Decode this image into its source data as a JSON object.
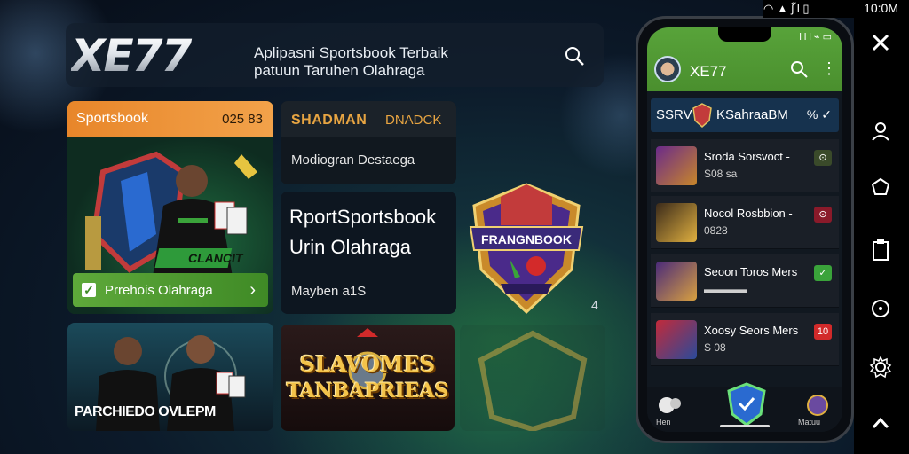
{
  "header": {
    "logo": "XE77",
    "tagline_line1": "Aplipasni Sportsbook Terbaik",
    "tagline_line2": "patuun Taruhen Olahraga",
    "search_icon": "search-icon"
  },
  "cards": {
    "sportsbook": {
      "title": "Sportsbook",
      "code": "025 83",
      "art_label": "CLANCIT",
      "cta_label": "Prrehois Olahraga",
      "cta_check": "✓",
      "cta_arrow": "›"
    },
    "shadman": {
      "tab1": "SHADMAN",
      "tab2": "DNADCK",
      "text": "Modiogran Destaega"
    },
    "rport": {
      "line1": "RportSportsbook",
      "line2": "Urin Olahraga",
      "line3": "Mayben a1S"
    },
    "shield": {
      "label": "FRANGNBOOK"
    },
    "small_glyph": "4",
    "players": {
      "label": "PARCHIEDO OVLEPM"
    },
    "slots": {
      "line1": "SLAVOMES",
      "line2": "TANBAPRIEAS"
    }
  },
  "phone": {
    "status": "l l l ⌁ ▭",
    "app_title": "XE77",
    "menu": "⋮",
    "sub_bar": {
      "title": "SSRV",
      "name": "KSahraaBM",
      "meta": "% ✓"
    },
    "items": [
      {
        "title": "Sroda Sorsvoct  -",
        "sub": "S08 sa",
        "badge": "⊙",
        "badge_color": "#3a4a2a"
      },
      {
        "title": "Nocol Rosbbion  -",
        "sub": "0828",
        "badge": "⊙",
        "badge_color": "#8a1a2a"
      },
      {
        "title": "Seoon Toros Mers",
        "sub": "▬▬▬▬",
        "badge": "✓",
        "badge_color": "#3aa33a"
      },
      {
        "title": "Xoosy Seors Mers",
        "sub": "S 08",
        "badge": "10",
        "badge_color": "#d22a2a"
      }
    ],
    "bottom_nav": {
      "left_label": "Hen",
      "right_label": "Matuu"
    }
  },
  "system": {
    "time": "10:0M",
    "status_icons": "◠ ▲ ʃ᷉ l ▯"
  },
  "colors": {
    "accent_orange": "#e8862a",
    "accent_green": "#5ea93a",
    "phone_appbar": "#58a33a",
    "sub_bar": "#16324e"
  }
}
